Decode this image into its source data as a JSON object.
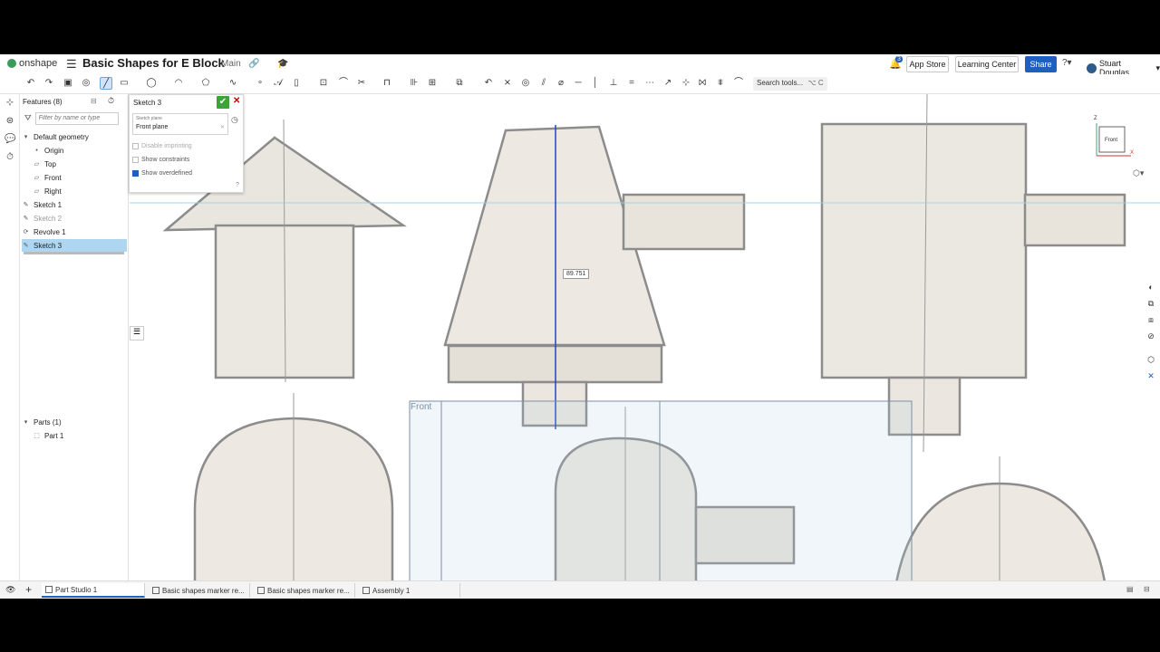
{
  "app": {
    "logo_text": "onshape"
  },
  "document": {
    "title": "Basic Shapes for E Block",
    "branch": "Main"
  },
  "header": {
    "notifications_count": "3",
    "app_store_label": "App Store",
    "learning_center_label": "Learning Center",
    "share_label": "Share",
    "user_name": "Stuart Douglas"
  },
  "toolbar": {
    "search_placeholder": "Search tools...",
    "search_shortcut": "⌥ C"
  },
  "features": {
    "header": "Features (8)",
    "filter_placeholder": "Filter by name or type",
    "items": [
      {
        "label": "Default geometry",
        "icon": "chevron-down-icon",
        "state": "normal"
      },
      {
        "label": "Origin",
        "icon": "origin-point-icon",
        "state": "normal"
      },
      {
        "label": "Top",
        "icon": "plane-icon",
        "state": "normal"
      },
      {
        "label": "Front",
        "icon": "plane-icon",
        "state": "normal"
      },
      {
        "label": "Right",
        "icon": "plane-icon",
        "state": "normal"
      },
      {
        "label": "Sketch 1",
        "icon": "sketch-icon",
        "state": "normal"
      },
      {
        "label": "Sketch 2",
        "icon": "sketch-icon",
        "state": "muted"
      },
      {
        "label": "Revolve 1",
        "icon": "revolve-icon",
        "state": "normal"
      },
      {
        "label": "Sketch 3",
        "icon": "sketch-icon",
        "state": "selected"
      }
    ],
    "parts_header": "Parts (1)",
    "parts": [
      "Part 1"
    ]
  },
  "sketch_dialog": {
    "title": "Sketch 3",
    "plane_label": "Sketch plane",
    "plane_value": "Front plane",
    "options": [
      {
        "label": "Disable imprinting",
        "checked": false,
        "enabled": false
      },
      {
        "label": "Show constraints",
        "checked": false,
        "enabled": true
      },
      {
        "label": "Show overdefined",
        "checked": true,
        "enabled": true
      }
    ]
  },
  "canvas": {
    "dimension_value": "89.751",
    "plane_label": "Front",
    "view_cube_face": "Front",
    "axis_z": "Z",
    "axis_x": "X"
  },
  "tabs": [
    {
      "label": "Part Studio 1",
      "active": true,
      "icon": "part-studio-icon"
    },
    {
      "label": "Basic shapes marker re...",
      "active": false,
      "icon": "image-icon"
    },
    {
      "label": "Basic shapes marker re...",
      "active": false,
      "icon": "image-icon"
    },
    {
      "label": "Assembly 1",
      "active": false,
      "icon": "assembly-icon"
    }
  ],
  "colors": {
    "accent": "#1f5fbf",
    "selected_row": "#aed6f1",
    "confirm": "#3aa33a",
    "cancel": "#cc0000"
  }
}
